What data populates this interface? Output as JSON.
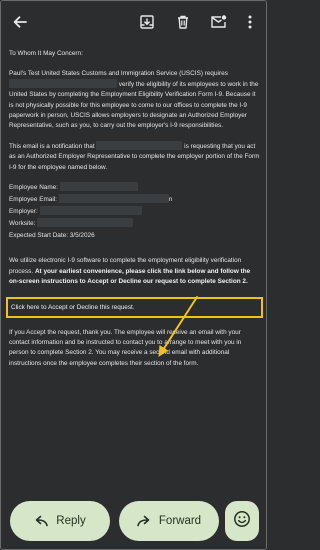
{
  "icons": {
    "back": "arrow-left-icon",
    "archive": "archive-icon",
    "delete": "trash-icon",
    "mark_unread": "mail-unread-icon",
    "more": "more-vertical-icon",
    "reply": "reply-icon",
    "forward": "forward-icon",
    "emoji": "emoji-reaction-icon"
  },
  "email": {
    "greeting": "To Whom It May Concern:",
    "p1_a": "Paul's Test United States Customs and Immigration Service (USCIS) requires",
    "p1_b": "verify the eligibility of its employees to work in",
    "p1_c": "the United States by completing the Employment Eligibility Verification Form I-9. Because it is not physically possible for this employee to come to our offices to complete the I-9 paperwork in person, USCIS allows employers to designate an Authorized Employer Representative, such as you, to carry out the employer's I-9 responsibilities.",
    "p2_a": "This email is a notification that",
    "p2_b": "is requesting that you act as an Authorized Employer Representative to complete the employer portion of the Form I-9 for the employee named below.",
    "field_name": "Employee Name:",
    "field_email": "Employee Email:",
    "field_email_tail": "n",
    "field_employer": "Employer:",
    "field_worksite": "Worksite:",
    "field_start": "Expected Start Date: 3/5/2026",
    "p3_a": "We utilize electronic I-9 software to complete the employment eligibility verification process.",
    "p3_b": "At your earliest convenience, please click the link below and follow the on-screen instructions to Accept or Decline our request to complete Section 2.",
    "link": "Click here to Accept or Decline this request.",
    "p4": "If you Accept the request, thank you. The employee will receive an email with your contact information and be instructed to contact you to arrange to meet with you in person to complete Section 2. You may receive a second email with additional instructions once the employee completes their section of the form."
  },
  "actions": {
    "reply_label": "Reply",
    "forward_label": "Forward"
  },
  "colors": {
    "background": "#2b2d2f",
    "button_bg": "#d6e7c9",
    "highlight": "#f2c21a"
  }
}
